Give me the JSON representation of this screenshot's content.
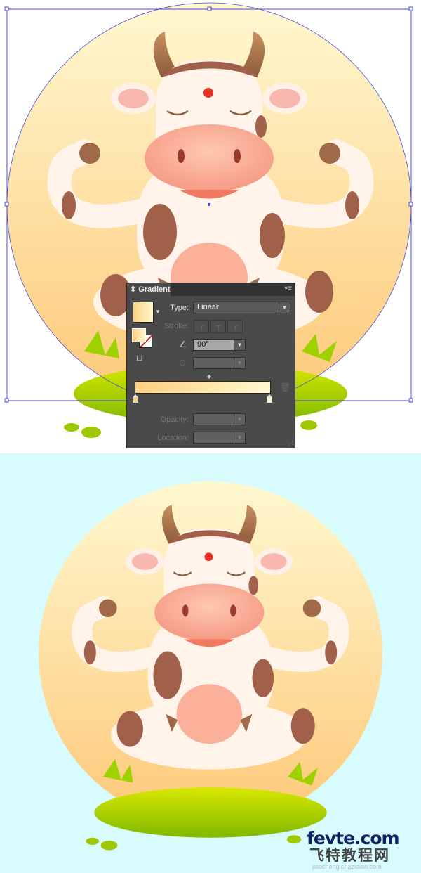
{
  "colors": {
    "gradient_start": "#fdd080",
    "gradient_end": "#fff8d0",
    "preview_background": "#d8fbfd",
    "selection": "#4a4ae0",
    "grass": "#9fd000"
  },
  "panel": {
    "title": "Gradient",
    "menu_icon": "panel-menu-icon",
    "type_label": "Type:",
    "type_value": "Linear",
    "stroke_label": "Stroke:",
    "angle_value": "90°",
    "aspect_value": "",
    "opacity_label": "Opacity:",
    "opacity_value": "",
    "location_label": "Location:",
    "location_value": ""
  },
  "watermark": {
    "logo": "fevte.com",
    "chinese": "飞特教程网",
    "url": "jiaocheng.chazidian.com"
  }
}
